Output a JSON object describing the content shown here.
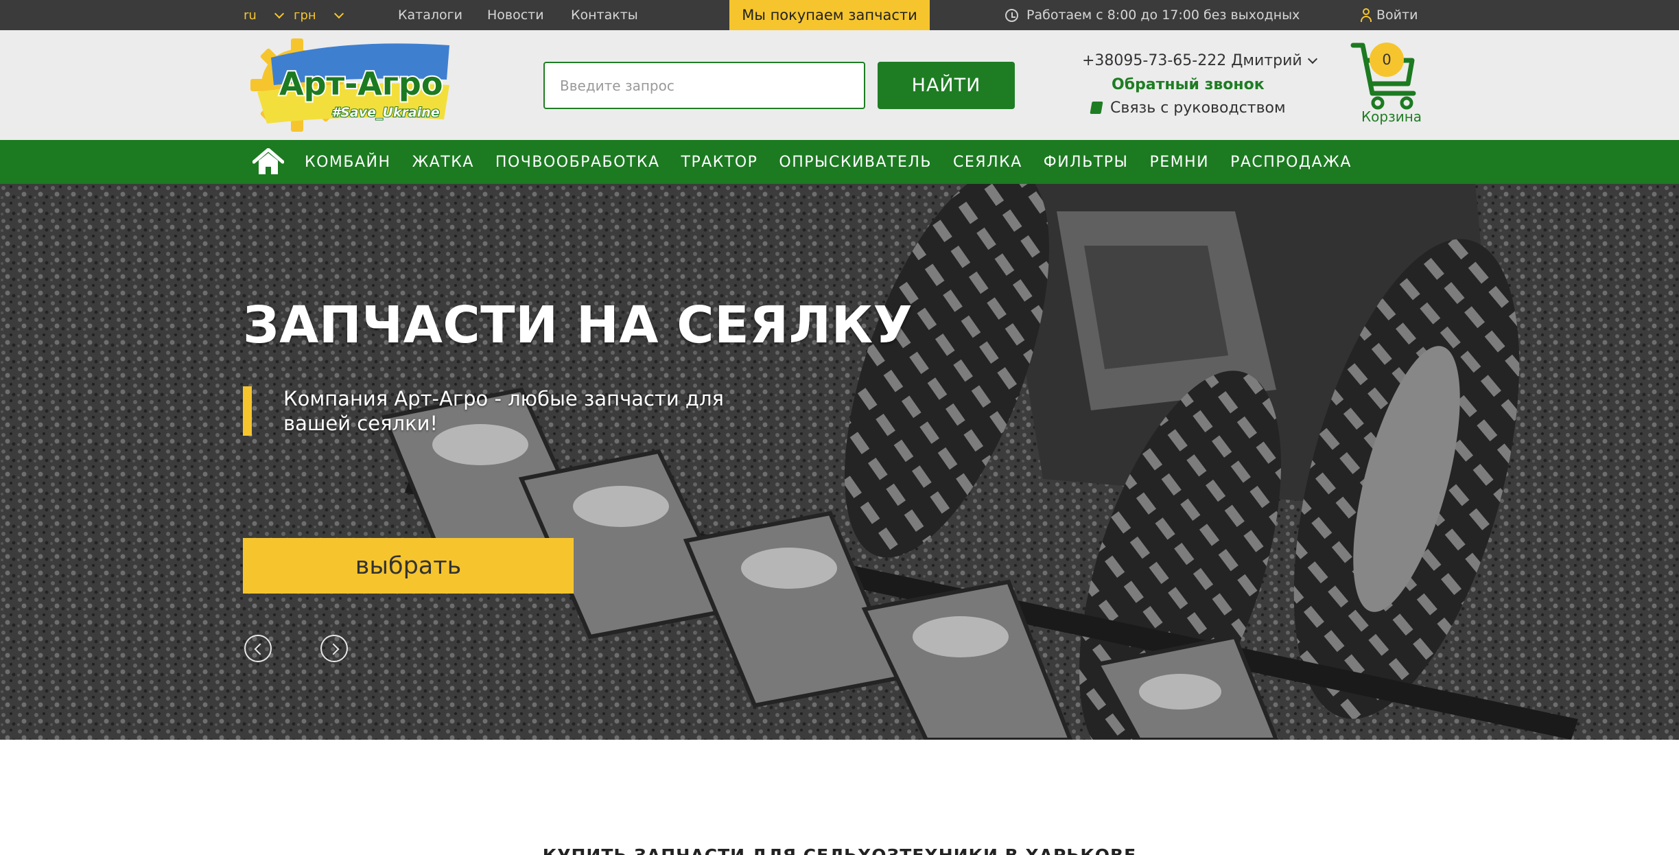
{
  "topbar": {
    "language": "ru",
    "currency": "грн",
    "links": [
      "Каталоги",
      "Новости",
      "Контакты"
    ],
    "banner": "Мы покупаем запчасти",
    "schedule": "Работаем с 8:00 до 17:00 без выходных",
    "login": "Войти"
  },
  "header": {
    "logo_text": "Арт-Агро",
    "logo_hashtag": "#Save_Ukraine",
    "search_placeholder": "Введите запрос",
    "search_button": "НАЙТИ",
    "phone": "+38095-73-65-222 Дмитрий",
    "callback": "Обратный звонок",
    "manager": "Связь с руководством",
    "cart_count": "0",
    "cart_label": "Корзина"
  },
  "nav": {
    "items": [
      "КОМБАЙН",
      "ЖАТКА",
      "ПОЧВООБРАБОТКА",
      "ТРАКТОР",
      "ОПРЫСКИВАТЕЛЬ",
      "СЕЯЛКА",
      "ФИЛЬТРЫ",
      "РЕМНИ",
      "РАСПРОДАЖА"
    ]
  },
  "hero": {
    "title": "ЗАПЧАСТИ НА СЕЯЛКУ",
    "subtitle": "Компания Арт-Агро - любые запчасти для вашей сеялки!",
    "button": "выбрать"
  },
  "section": {
    "heading": "КУПИТЬ ЗАПЧАСТИ ДЛЯ СЕЛЬХОЗТЕХНИКИ В ХАРЬКОВЕ"
  },
  "colors": {
    "brand_green": "#1c7a21",
    "accent_yellow": "#f6c52e",
    "topbar_bg": "#3b3b3b",
    "header_bg": "#ececec"
  }
}
